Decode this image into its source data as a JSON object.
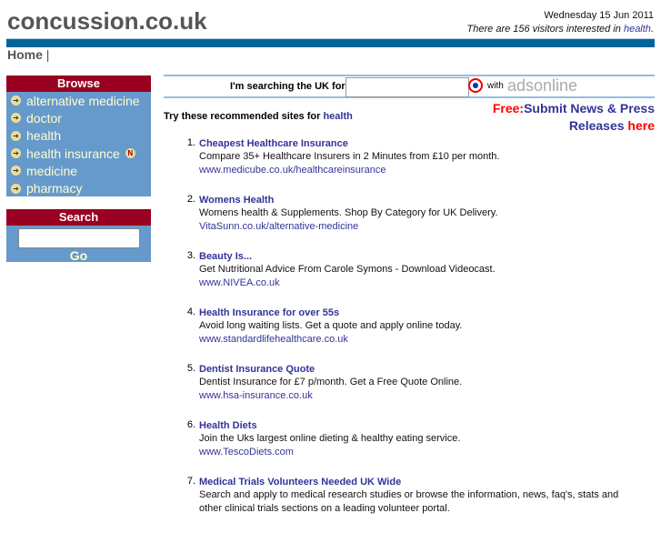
{
  "header": {
    "logo": "concussion.co.uk",
    "date": "Wednesday 15 Jun 2011",
    "visitors_prefix": "There are 156 visitors interested in ",
    "visitors_link": "health",
    "visitors_suffix": "."
  },
  "nav": {
    "home": "Home",
    "separator": "|"
  },
  "browse": {
    "title": "Browse",
    "items": [
      {
        "label": "alternative medicine"
      },
      {
        "label": "doctor"
      },
      {
        "label": "health"
      },
      {
        "label": "health insurance",
        "badge": "N"
      },
      {
        "label": "medicine"
      },
      {
        "label": "pharmacy"
      }
    ]
  },
  "search": {
    "title": "Search",
    "input_value": "",
    "go": "Go"
  },
  "ads": {
    "label": "I'm searching the UK for...",
    "input_value": "",
    "with": "with",
    "brand": "adsonline"
  },
  "try": {
    "prefix": "Try these recommended sites for ",
    "link": "health"
  },
  "promo": {
    "free": "Free:",
    "line1": "Submit News & Press",
    "line2": "Releases ",
    "here": "here"
  },
  "results": [
    {
      "n": "1.",
      "title": "Cheapest Healthcare Insurance",
      "desc": "Compare 35+ Healthcare Insurers in 2 Minutes from £10 per month.",
      "url": "www.medicube.co.uk/healthcareinsurance"
    },
    {
      "n": "2.",
      "title": "Womens Health",
      "desc": "Womens health & Supplements. Shop By Category for UK Delivery.",
      "url": "VitaSunn.co.uk/alternative-medicine"
    },
    {
      "n": "3.",
      "title": "Beauty Is...",
      "desc": "Get Nutritional Advice From Carole Symons - Download Videocast.",
      "url": "www.NIVEA.co.uk"
    },
    {
      "n": "4.",
      "title": "Health Insurance for over 55s",
      "desc": "Avoid long waiting lists. Get a quote and apply online today.",
      "url": "www.standardlifehealthcare.co.uk"
    },
    {
      "n": "5.",
      "title": "Dentist Insurance Quote",
      "desc": "Dentist Insurance for £7 p/month. Get a Free Quote Online.",
      "url": "www.hsa-insurance.co.uk"
    },
    {
      "n": "6.",
      "title": "Health Diets",
      "desc": "Join the Uks largest online dieting & healthy eating service.",
      "url": "www.TescoDiets.com"
    },
    {
      "n": "7.",
      "title": "Medical Trials Volunteers Needed UK Wide",
      "desc": "Search and apply to medical research studies or browse the information, news, faq's, stats and other clinical trials sections on a leading volunteer portal.",
      "url": ""
    }
  ]
}
